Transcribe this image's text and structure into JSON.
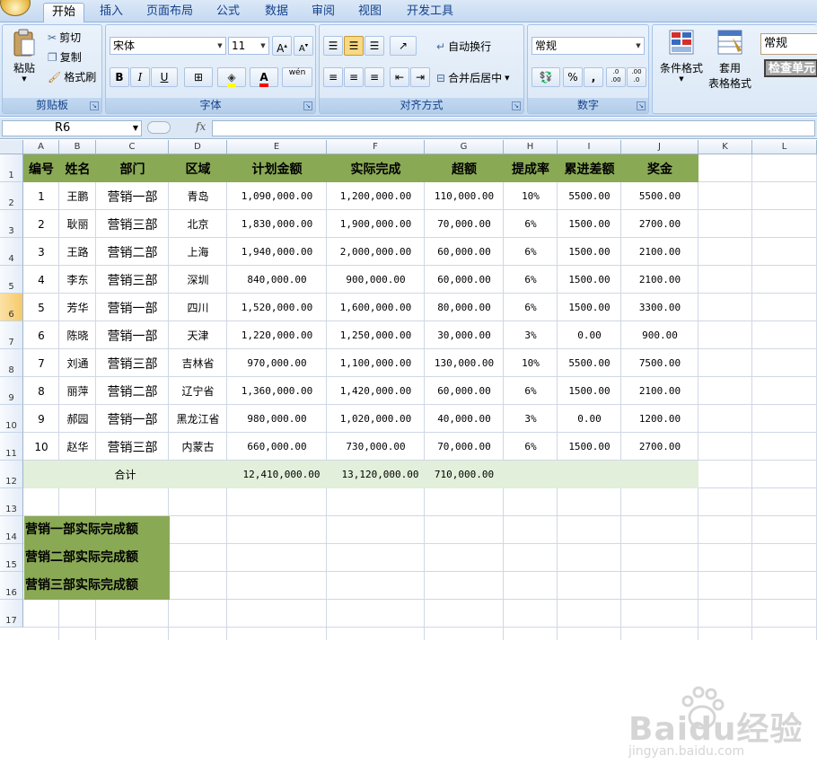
{
  "ribbon": {
    "tabs": [
      "开始",
      "插入",
      "页面布局",
      "公式",
      "数据",
      "审阅",
      "视图",
      "开发工具"
    ],
    "active_tab": "开始",
    "clipboard": {
      "paste": "粘贴",
      "cut": "剪切",
      "copy": "复制",
      "format_painter": "格式刷",
      "label": "剪贴板"
    },
    "font": {
      "name": "宋体",
      "size": "11",
      "bold": "B",
      "italic": "I",
      "underline": "U",
      "phonetic": "wén",
      "label": "字体"
    },
    "alignment": {
      "wrap_text": "自动换行",
      "merge_center": "合并后居中",
      "label": "对齐方式"
    },
    "number": {
      "format": "常规",
      "percent": "%",
      "comma": ",",
      "inc_dec": ".0 .00",
      "dec_dec": ".00 .0",
      "label": "数字"
    },
    "styles": {
      "conditional_format": "条件格式",
      "format_as_table_1": "套用",
      "format_as_table_2": "表格格式",
      "cell_style_combo": "常规",
      "check_cell": "检查单元"
    }
  },
  "formula_bar": {
    "name_box": "R6",
    "fx": "fx",
    "formula": ""
  },
  "columns": [
    "A",
    "B",
    "C",
    "D",
    "E",
    "F",
    "G",
    "H",
    "I",
    "J",
    "K",
    "L"
  ],
  "rows": [
    "1",
    "2",
    "3",
    "4",
    "5",
    "6",
    "7",
    "8",
    "9",
    "10",
    "11",
    "12",
    "13",
    "14",
    "15",
    "16",
    "17"
  ],
  "selected_row": "6",
  "table": {
    "headers": [
      "编号",
      "姓名",
      "部门",
      "区域",
      "计划金额",
      "实际完成",
      "超额",
      "提成率",
      "累进差额",
      "奖金"
    ],
    "rows": [
      [
        "1",
        "王鹏",
        "营销一部",
        "青岛",
        "1,090,000.00",
        "1,200,000.00",
        "110,000.00",
        "10%",
        "5500.00",
        "5500.00"
      ],
      [
        "2",
        "耿丽",
        "营销三部",
        "北京",
        "1,830,000.00",
        "1,900,000.00",
        "70,000.00",
        "6%",
        "1500.00",
        "2700.00"
      ],
      [
        "3",
        "王路",
        "营销二部",
        "上海",
        "1,940,000.00",
        "2,000,000.00",
        "60,000.00",
        "6%",
        "1500.00",
        "2100.00"
      ],
      [
        "4",
        "李东",
        "营销三部",
        "深圳",
        "840,000.00",
        "900,000.00",
        "60,000.00",
        "6%",
        "1500.00",
        "2100.00"
      ],
      [
        "5",
        "芳华",
        "营销一部",
        "四川",
        "1,520,000.00",
        "1,600,000.00",
        "80,000.00",
        "6%",
        "1500.00",
        "3300.00"
      ],
      [
        "6",
        "陈晓",
        "营销一部",
        "天津",
        "1,220,000.00",
        "1,250,000.00",
        "30,000.00",
        "3%",
        "0.00",
        "900.00"
      ],
      [
        "7",
        "刘通",
        "营销三部",
        "吉林省",
        "970,000.00",
        "1,100,000.00",
        "130,000.00",
        "10%",
        "5500.00",
        "7500.00"
      ],
      [
        "8",
        "丽萍",
        "营销二部",
        "辽宁省",
        "1,360,000.00",
        "1,420,000.00",
        "60,000.00",
        "6%",
        "1500.00",
        "2100.00"
      ],
      [
        "9",
        "郝园",
        "营销一部",
        "黑龙江省",
        "980,000.00",
        "1,020,000.00",
        "40,000.00",
        "3%",
        "0.00",
        "1200.00"
      ],
      [
        "10",
        "赵华",
        "营销三部",
        "内蒙古",
        "660,000.00",
        "730,000.00",
        "70,000.00",
        "6%",
        "1500.00",
        "2700.00"
      ]
    ],
    "total": {
      "label": "合计",
      "plan": "12,410,000.00",
      "actual": "13,120,000.00",
      "excess": "710,000.00"
    }
  },
  "summary_labels": [
    "营销一部实际完成额",
    "营销二部实际完成额",
    "营销三部实际完成额"
  ],
  "colors": {
    "header_green": "#8aa955",
    "total_green": "#e2efda",
    "selected_row": "#f6c96b"
  },
  "watermark": {
    "text": "Baidu经验",
    "sub": "jingyan.baidu.com"
  }
}
